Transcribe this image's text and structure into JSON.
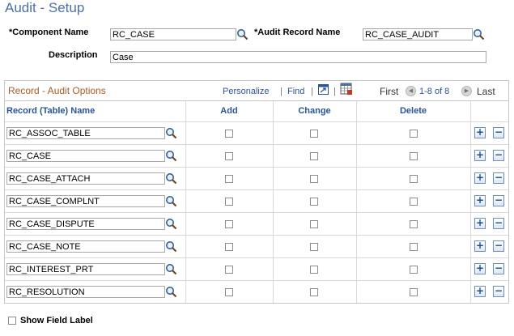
{
  "page": {
    "title": "Audit - Setup"
  },
  "form": {
    "component_name": {
      "label": "*Component Name",
      "value": "RC_CASE"
    },
    "audit_record_name": {
      "label": "*Audit Record Name",
      "value": "RC_CASE_AUDIT"
    },
    "description": {
      "label": "Description",
      "value": "Case"
    }
  },
  "grid": {
    "title": "Record - Audit Options",
    "personalize": "Personalize",
    "separator": "|",
    "find": "Find",
    "first": "First",
    "range": "1-8 of 8",
    "last": "Last",
    "columns": {
      "record": "Record (Table) Name",
      "add": "Add",
      "change": "Change",
      "delete": "Delete"
    },
    "rows": [
      {
        "record": "RC_ASSOC_TABLE"
      },
      {
        "record": "RC_CASE"
      },
      {
        "record": "RC_CASE_ATTACH"
      },
      {
        "record": "RC_CASE_COMPLNT"
      },
      {
        "record": "RC_CASE_DISPUTE"
      },
      {
        "record": "RC_CASE_NOTE"
      },
      {
        "record": "RC_INTEREST_PRT"
      },
      {
        "record": "RC_RESOLUTION"
      }
    ],
    "add_symbol": "+",
    "remove_symbol": "−"
  },
  "footer": {
    "show_field_label": "Show Field Label"
  },
  "icons": {
    "lookup": "magnifier-icon",
    "view_all": "view-all-icon",
    "download": "download-to-excel-icon",
    "previous": "previous-arrow-icon",
    "next": "next-arrow-icon"
  },
  "colors": {
    "title": "#4c6fa7",
    "grid_title": "#a55f2a",
    "link": "#2a5594"
  }
}
